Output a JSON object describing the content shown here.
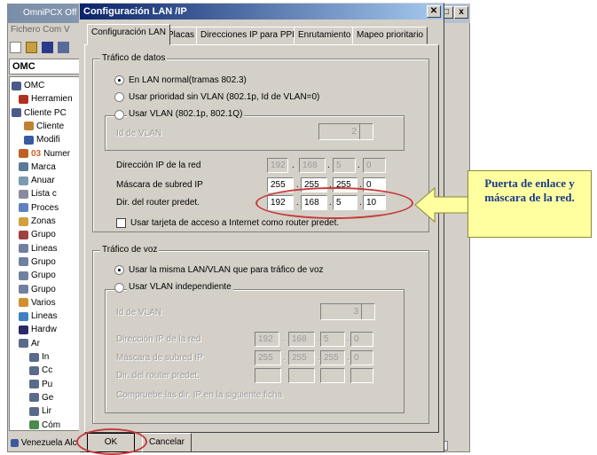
{
  "background_app": {
    "title": "OmniPCX Off",
    "menu": "Fichero  Com  V",
    "omc_header": "OMC",
    "tree": [
      "OMC",
      "Herramien",
      "Cliente PC",
      "Cliente",
      "Modifi",
      "Numer",
      "Marca",
      "Anuar",
      "Lista c",
      "Proces",
      "Zonas",
      "Grupo",
      "Lineas",
      "Grupo",
      "Grupo",
      "Grupo",
      "Varios",
      "Lineas",
      "Hardw",
      "Ar",
      "In",
      "Cc",
      "Pu",
      "Ge",
      "Lir",
      "Cóm"
    ],
    "tree_prefix_03": "03",
    "status": "Venezuela Alc"
  },
  "dialog": {
    "title": "Configuración LAN /IP",
    "close_glyph": "✕",
    "tabs": [
      "Configuración LAN",
      "Placas",
      "Direcciones IP para PPP",
      "Enrutamiento",
      "Mapeo prioritario"
    ],
    "data_group": {
      "legend": "Tráfico de datos",
      "radio_lan_normal": "En LAN normal(tramas 802.3)",
      "radio_priority": "Usar prioridad sin VLAN (802.1p, Id de VLAN=0)",
      "radio_vlan": "Usar VLAN (802.1p, 802.1Q)",
      "vlan_id_label": "Id de VLAN",
      "vlan_id_value": "2",
      "net_ip_label": "Dirección IP de la red",
      "net_ip": [
        "192",
        "168",
        "5",
        "0"
      ],
      "mask_label": "Máscara de subred IP",
      "mask": [
        "255",
        "255",
        "255",
        "0"
      ],
      "router_label": "Dir. del router predet.",
      "router": [
        "192",
        "168",
        "5",
        "10"
      ],
      "internet_check": "Usar tarjeta de acceso a Internet como router predet."
    },
    "voice_group": {
      "legend": "Tráfico de voz",
      "radio_same": "Usar la misma LAN/VLAN que para tráfico de voz",
      "radio_indep": "Usar VLAN independiente",
      "vlan_id_label": "Id de VLAN",
      "vlan_id_value": "3",
      "ip_label": "Dirección IP de la red",
      "ip": [
        "192",
        "168",
        "5",
        "0"
      ],
      "mask_label": "Máscara de subred IP",
      "mask": [
        "255",
        "255",
        "255",
        "0"
      ],
      "router_label": "Dir. del router predet.",
      "note": "Compruebe las dir. IP en la siguiente ficha"
    },
    "ok": "OK",
    "cancel": "Cancelar"
  },
  "callout": {
    "text": "Puerta de enlace y máscara de la red."
  },
  "colors": {
    "highlight": "#c43b3b",
    "callout_bg": "#ffffa0",
    "callout_text": "#1a3a8a",
    "title_active": "#0a246a"
  }
}
